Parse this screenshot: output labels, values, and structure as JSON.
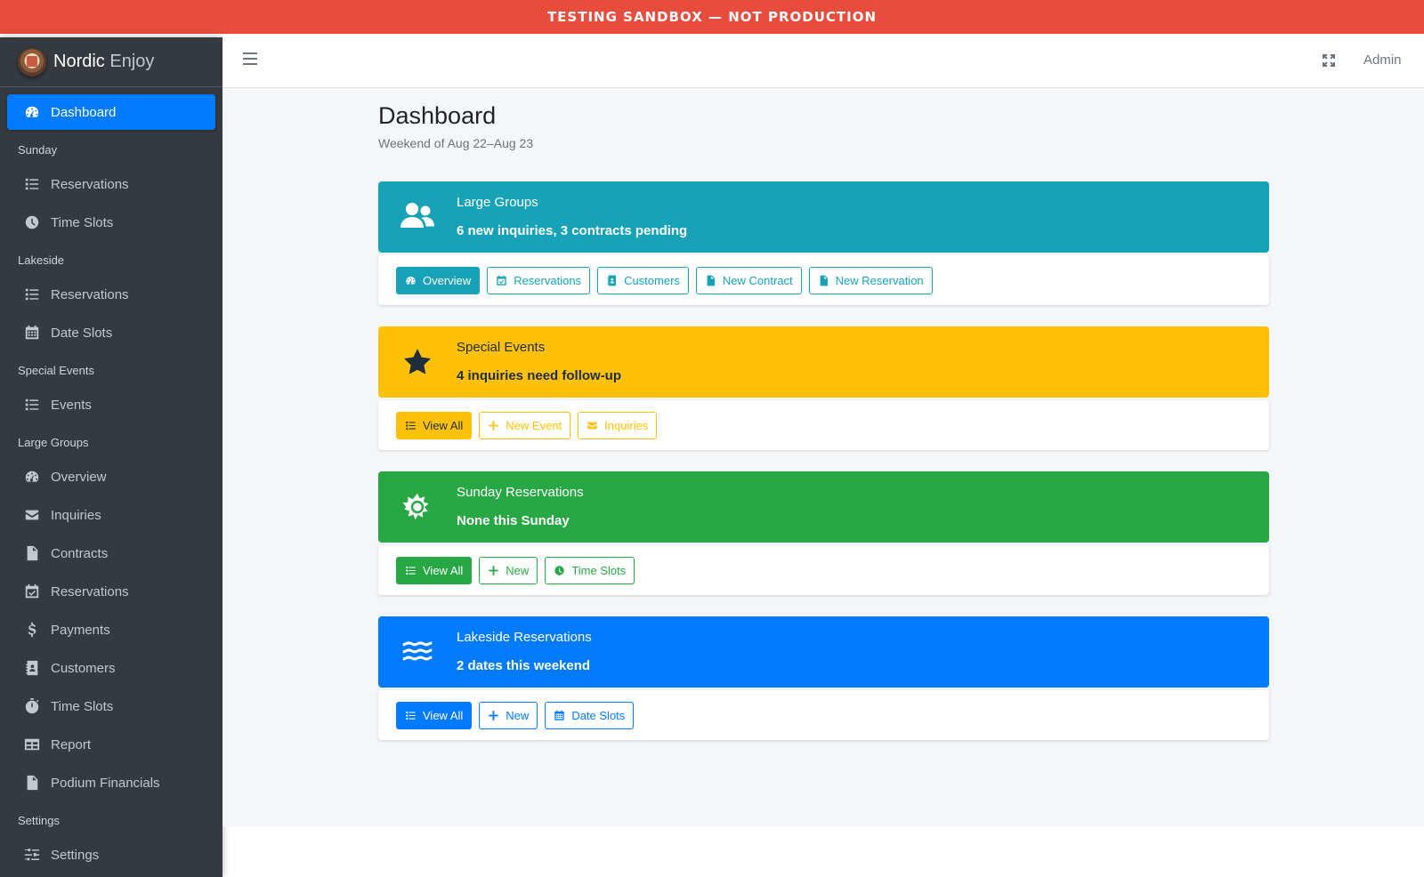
{
  "banner": {
    "text": "TESTING SANDBOX — NOT PRODUCTION",
    "color": "#e74c3c"
  },
  "brand": {
    "name_bold": "Nordic",
    "name_light": "Enjoy"
  },
  "topbar": {
    "user": "Admin"
  },
  "sidebar": {
    "active": {
      "label": "Dashboard",
      "icon": "dashboard-icon"
    },
    "sections": [
      {
        "header": "Sunday",
        "items": [
          {
            "label": "Reservations",
            "icon": "list-icon"
          },
          {
            "label": "Time Slots",
            "icon": "clock-icon"
          }
        ]
      },
      {
        "header": "Lakeside",
        "items": [
          {
            "label": "Reservations",
            "icon": "list-icon"
          },
          {
            "label": "Date Slots",
            "icon": "calendar-icon"
          }
        ]
      },
      {
        "header": "Special Events",
        "items": [
          {
            "label": "Events",
            "icon": "list-icon"
          }
        ]
      },
      {
        "header": "Large Groups",
        "items": [
          {
            "label": "Overview",
            "icon": "dashboard-icon"
          },
          {
            "label": "Inquiries",
            "icon": "envelope-icon"
          },
          {
            "label": "Contracts",
            "icon": "contract-icon"
          },
          {
            "label": "Reservations",
            "icon": "calendar-check-icon"
          },
          {
            "label": "Payments",
            "icon": "dollar-icon"
          },
          {
            "label": "Customers",
            "icon": "address-book-icon"
          },
          {
            "label": "Time Slots",
            "icon": "stopwatch-icon"
          },
          {
            "label": "Report",
            "icon": "table-icon"
          },
          {
            "label": "Podium Financials",
            "icon": "invoice-icon"
          }
        ]
      },
      {
        "header": "Settings",
        "items": [
          {
            "label": "Settings",
            "icon": "sliders-icon"
          }
        ]
      }
    ]
  },
  "main": {
    "title": "Dashboard",
    "subtitle": "Weekend of Aug 22–Aug 23",
    "panels": [
      {
        "title": "Large Groups",
        "detail": "6 new inquiries, 3 contracts pending",
        "icon": "users-icon",
        "color": "#17a2b8",
        "buttons": [
          {
            "label": "Overview",
            "icon": "dashboard-icon"
          },
          {
            "label": "Reservations",
            "icon": "calendar-check-icon"
          },
          {
            "label": "Customers",
            "icon": "address-book-icon"
          },
          {
            "label": "New Contract",
            "icon": "contract-icon"
          },
          {
            "label": "New Reservation",
            "icon": "file-icon"
          }
        ]
      },
      {
        "title": "Special Events",
        "detail": "4 inquiries need follow-up",
        "icon": "star-icon",
        "color": "#ffc107",
        "buttons": [
          {
            "label": "View All",
            "icon": "list-icon"
          },
          {
            "label": "New Event",
            "icon": "plus-icon"
          },
          {
            "label": "Inquiries",
            "icon": "envelope-icon"
          }
        ]
      },
      {
        "title": "Sunday Reservations",
        "detail": "None this Sunday",
        "icon": "sun-icon",
        "color": "#28a745",
        "buttons": [
          {
            "label": "View All",
            "icon": "list-icon"
          },
          {
            "label": "New",
            "icon": "plus-icon"
          },
          {
            "label": "Time Slots",
            "icon": "clock-icon"
          }
        ]
      },
      {
        "title": "Lakeside Reservations",
        "detail": "2 dates this weekend",
        "icon": "water-icon",
        "color": "#007bff",
        "buttons": [
          {
            "label": "View All",
            "icon": "list-icon"
          },
          {
            "label": "New",
            "icon": "plus-icon"
          },
          {
            "label": "Date Slots",
            "icon": "calendar-icon"
          }
        ]
      }
    ]
  }
}
